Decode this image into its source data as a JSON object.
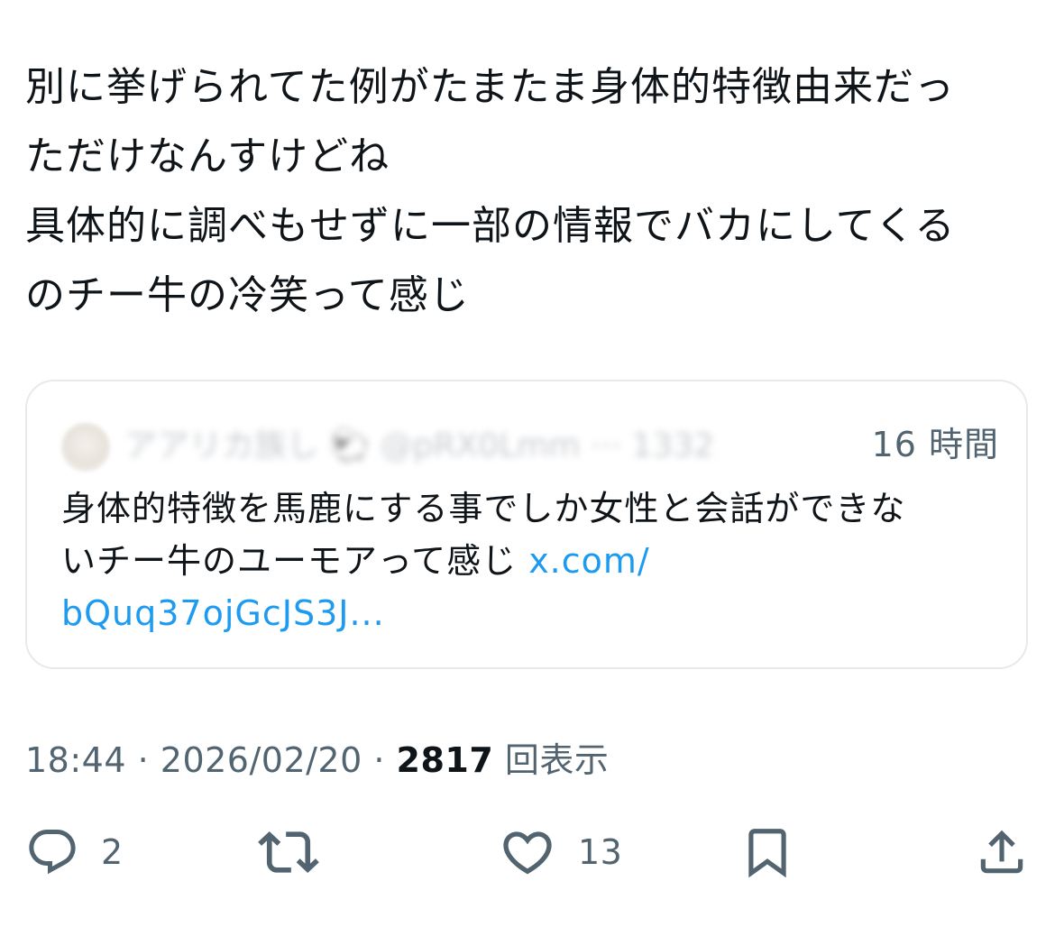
{
  "tweet": {
    "text_lines": [
      "別に挙げられてた例がたまたま身体的特徴由来だっ",
      "ただけなんすけどね",
      "具体的に調べもせずに一部の情報でバカにしてくる",
      "のチー牛の冷笑って感じ"
    ]
  },
  "quote": {
    "author_blurred": "アアリカ族し 🐑 @pRX0Lmm ··· 1332",
    "time": "16 時間",
    "text_lines": [
      "身体的特徴を馬鹿にする事でしか女性と会話ができな",
      "いチー牛のユーモアって感じ "
    ],
    "link_part1": "x.com/",
    "link_part2": "bQuq37ojGcJS3J..."
  },
  "meta": {
    "time": "18:44",
    "separator": " · ",
    "date": "2026/02/20",
    "views_count": "2817",
    "views_label": " 回表示"
  },
  "actions": {
    "reply_count": "2",
    "like_count": "13"
  },
  "colors": {
    "text": "#0f1419",
    "secondary": "#536471",
    "link": "#1d9bf0",
    "border": "#e7e9ec"
  },
  "icons": [
    "reply-icon",
    "retweet-icon",
    "like-icon",
    "bookmark-icon",
    "share-icon"
  ]
}
